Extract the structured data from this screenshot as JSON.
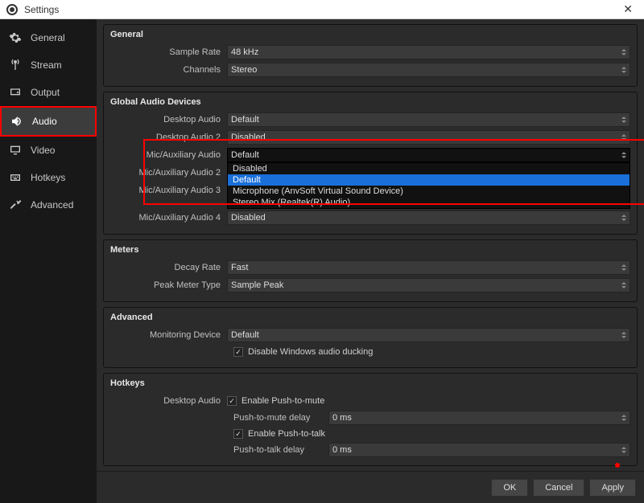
{
  "window": {
    "title": "Settings"
  },
  "sidebar": {
    "items": [
      {
        "label": "General"
      },
      {
        "label": "Stream"
      },
      {
        "label": "Output"
      },
      {
        "label": "Audio"
      },
      {
        "label": "Video"
      },
      {
        "label": "Hotkeys"
      },
      {
        "label": "Advanced"
      }
    ]
  },
  "general": {
    "title": "General",
    "sample_rate_label": "Sample Rate",
    "sample_rate_value": "48 kHz",
    "channels_label": "Channels",
    "channels_value": "Stereo"
  },
  "global_audio": {
    "title": "Global Audio Devices",
    "desktop_audio_label": "Desktop Audio",
    "desktop_audio_value": "Default",
    "desktop_audio2_label": "Desktop Audio 2",
    "desktop_audio2_value": "Disabled",
    "mic1_label": "Mic/Auxiliary Audio",
    "mic1_value": "Default",
    "mic1_options": [
      "Disabled",
      "Default",
      "Microphone (AnvSoft Virtual Sound Device)",
      "Stereo Mix (Realtek(R) Audio)"
    ],
    "mic2_label": "Mic/Auxiliary Audio 2",
    "mic3_label": "Mic/Auxiliary Audio 3",
    "mic4_label": "Mic/Auxiliary Audio 4",
    "mic4_value": "Disabled"
  },
  "meters": {
    "title": "Meters",
    "decay_label": "Decay Rate",
    "decay_value": "Fast",
    "peak_label": "Peak Meter Type",
    "peak_value": "Sample Peak"
  },
  "advanced": {
    "title": "Advanced",
    "monitoring_label": "Monitoring Device",
    "monitoring_value": "Default",
    "disable_ducking": "Disable Windows audio ducking"
  },
  "hotkeys": {
    "title": "Hotkeys",
    "desktop_audio_label": "Desktop Audio",
    "enable_ptm": "Enable Push-to-mute",
    "ptm_delay_label": "Push-to-mute delay",
    "ptm_delay_value": "0 ms",
    "enable_ptt": "Enable Push-to-talk",
    "ptt_delay_label": "Push-to-talk delay",
    "ptt_delay_value": "0 ms"
  },
  "footer": {
    "ok": "OK",
    "cancel": "Cancel",
    "apply": "Apply"
  }
}
